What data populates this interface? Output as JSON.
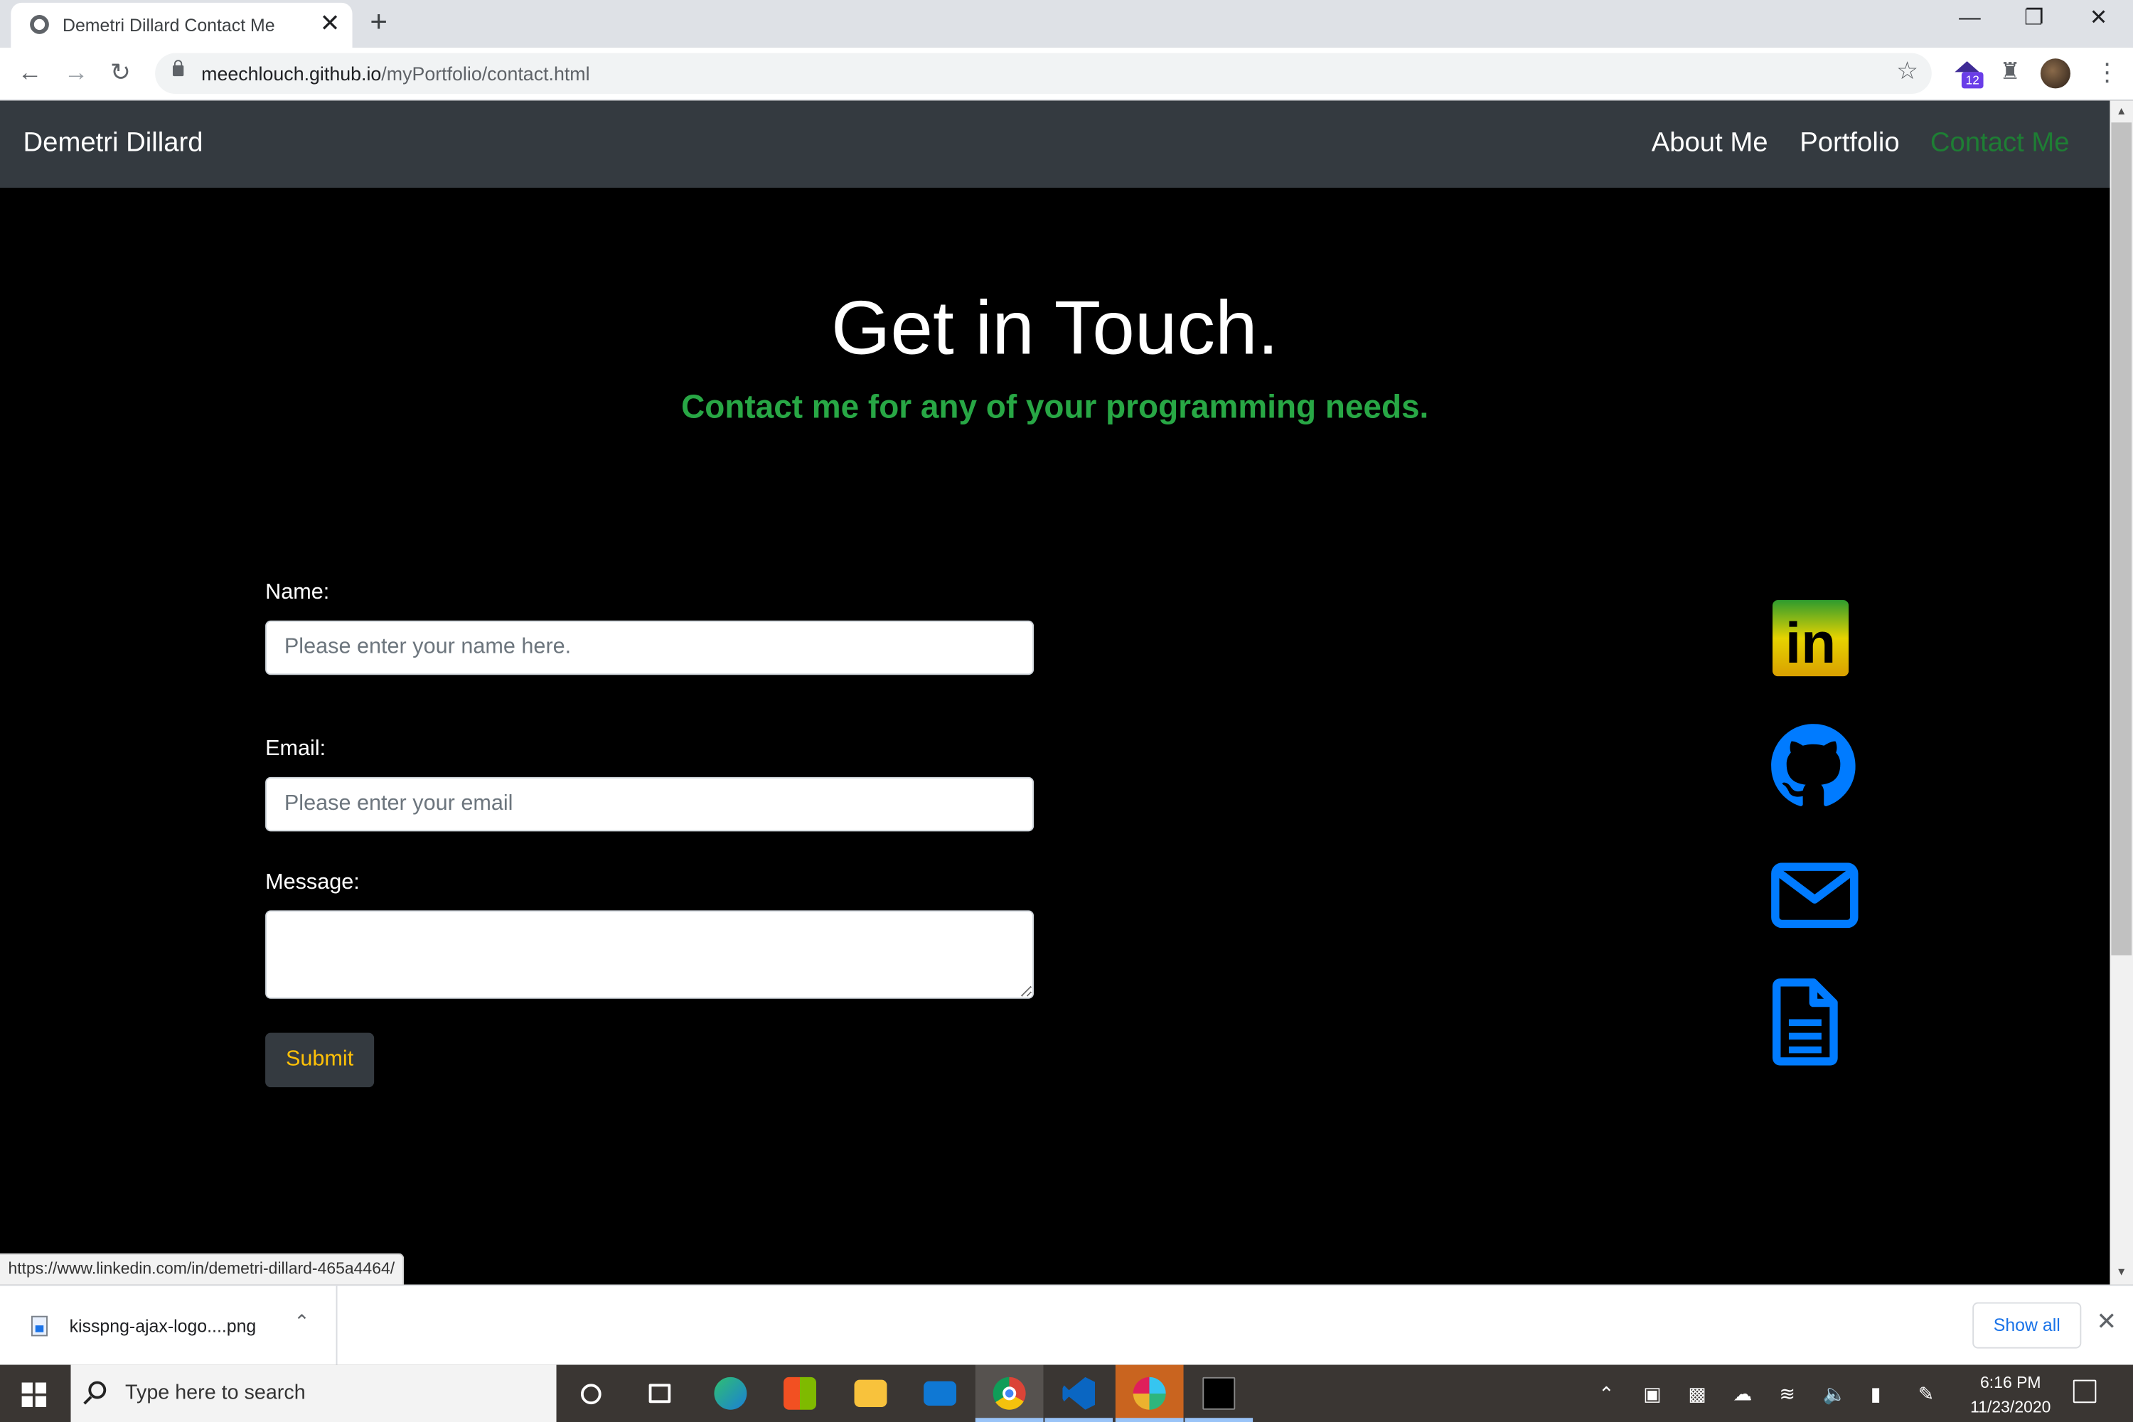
{
  "browser": {
    "tab_title": "Demetri Dillard Contact Me",
    "tab_close": "✕",
    "new_tab": "+",
    "url_host": "meechlouch.github.io",
    "url_path": "/myPortfolio/contact.html",
    "extension_badge": "12",
    "window_controls": {
      "minimize": "—",
      "restore": "❐",
      "close": "✕"
    }
  },
  "site": {
    "brand": "Demetri Dillard",
    "nav": [
      {
        "label": "About Me",
        "color": "#ffffff"
      },
      {
        "label": "Portfolio",
        "color": "#ffffff"
      },
      {
        "label": "Contact Me",
        "color": "#1e7e34"
      }
    ],
    "hero": {
      "title": "Get in Touch.",
      "subtitle": "Contact me for any of your programming needs."
    },
    "form": {
      "name_label": "Name:",
      "name_placeholder": "Please enter your name here.",
      "email_label": "Email:",
      "email_placeholder": "Please enter your email",
      "message_label": "Message:",
      "message_value": "",
      "submit_label": "Submit"
    },
    "social_icons": [
      "linkedin-icon",
      "github-icon",
      "email-icon",
      "resume-document-icon"
    ],
    "linkedin_icon_text": "in",
    "status_url": "https://www.linkedin.com/in/demetri-dillard-465a4464/"
  },
  "downloads": {
    "file_name": "kisspng-ajax-logo....png",
    "show_all": "Show all"
  },
  "taskbar": {
    "search_placeholder": "Type here to search",
    "time": "6:16 PM",
    "date": "11/23/2020"
  },
  "colors": {
    "accent_green": "#28a745",
    "nav_bg": "#343a40",
    "submit_text": "#ffc107",
    "icon_blue": "#007bff"
  }
}
